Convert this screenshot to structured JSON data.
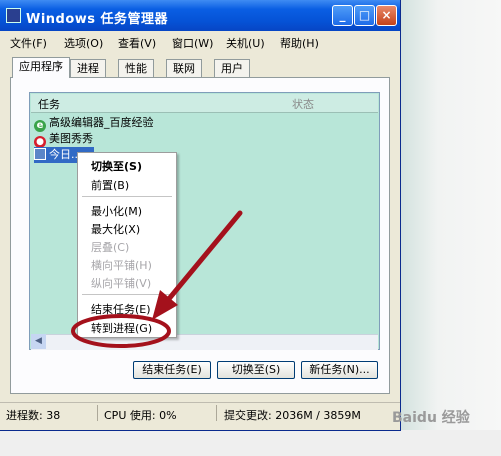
{
  "window": {
    "title": "Windows 任务管理器",
    "buttons": {
      "minimize": "_",
      "maximize": "□",
      "close": "×"
    }
  },
  "menubar": [
    "文件(F)",
    "选项(O)",
    "查看(V)",
    "窗口(W)",
    "关机(U)",
    "帮助(H)"
  ],
  "tabs": [
    "应用程序",
    "进程",
    "性能",
    "联网",
    "用户"
  ],
  "active_tab": "应用程序",
  "task_list": {
    "columns": [
      "任务",
      "状态"
    ],
    "rows": [
      "高级编辑器_百度经验",
      "美图秀秀",
      "今日..."
    ]
  },
  "context_menu": {
    "items": [
      "切换至(S)",
      "前置(B)",
      "最小化(M)",
      "最大化(X)",
      "层叠(C)",
      "横向平铺(H)",
      "纵向平铺(V)",
      "结束任务(E)",
      "转到进程(G)"
    ],
    "disabled": [
      "层叠(C)",
      "横向平铺(H)",
      "纵向平铺(V)"
    ]
  },
  "buttons": {
    "end_task": "结束任务(E)",
    "switch_to": "切换至(S)",
    "new_task": "新任务(N)..."
  },
  "statusbar": {
    "processes": "进程数: 38",
    "cpu": "CPU 使用: 0%",
    "commit": "提交更改: 2036M / 3859M"
  },
  "watermark": "Baidu 经验",
  "colors": {
    "titlebar": "#0552d6",
    "list_bg": "#b8e6d8",
    "arrow": "#a4111c",
    "selection": "#316ac5"
  }
}
